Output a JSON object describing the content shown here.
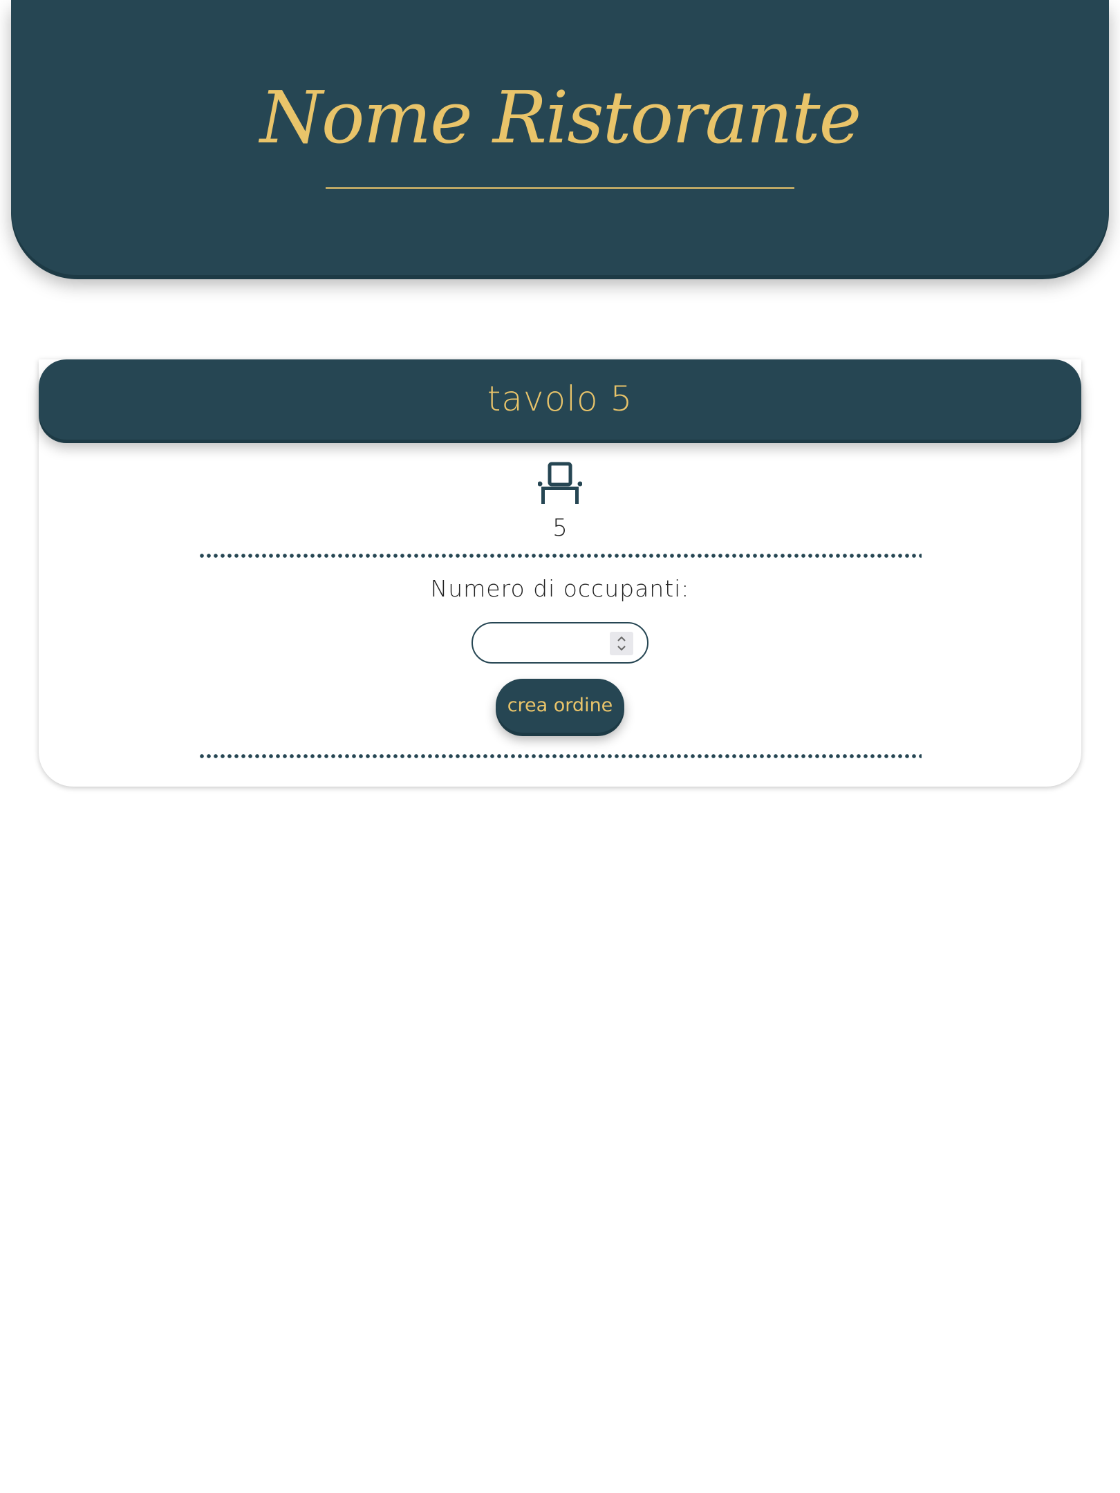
{
  "header": {
    "title": "Nome Ristorante"
  },
  "table_card": {
    "title": "tavolo 5",
    "icon": "chair-icon",
    "seats": "5",
    "occupants_label": "Numero di occupanti:",
    "occupants_input": {
      "value": "",
      "placeholder": ""
    },
    "create_order_label": "crea ordine"
  },
  "colors": {
    "primary": "#264653",
    "accent": "#e9c46a",
    "background": "#ffffff"
  }
}
